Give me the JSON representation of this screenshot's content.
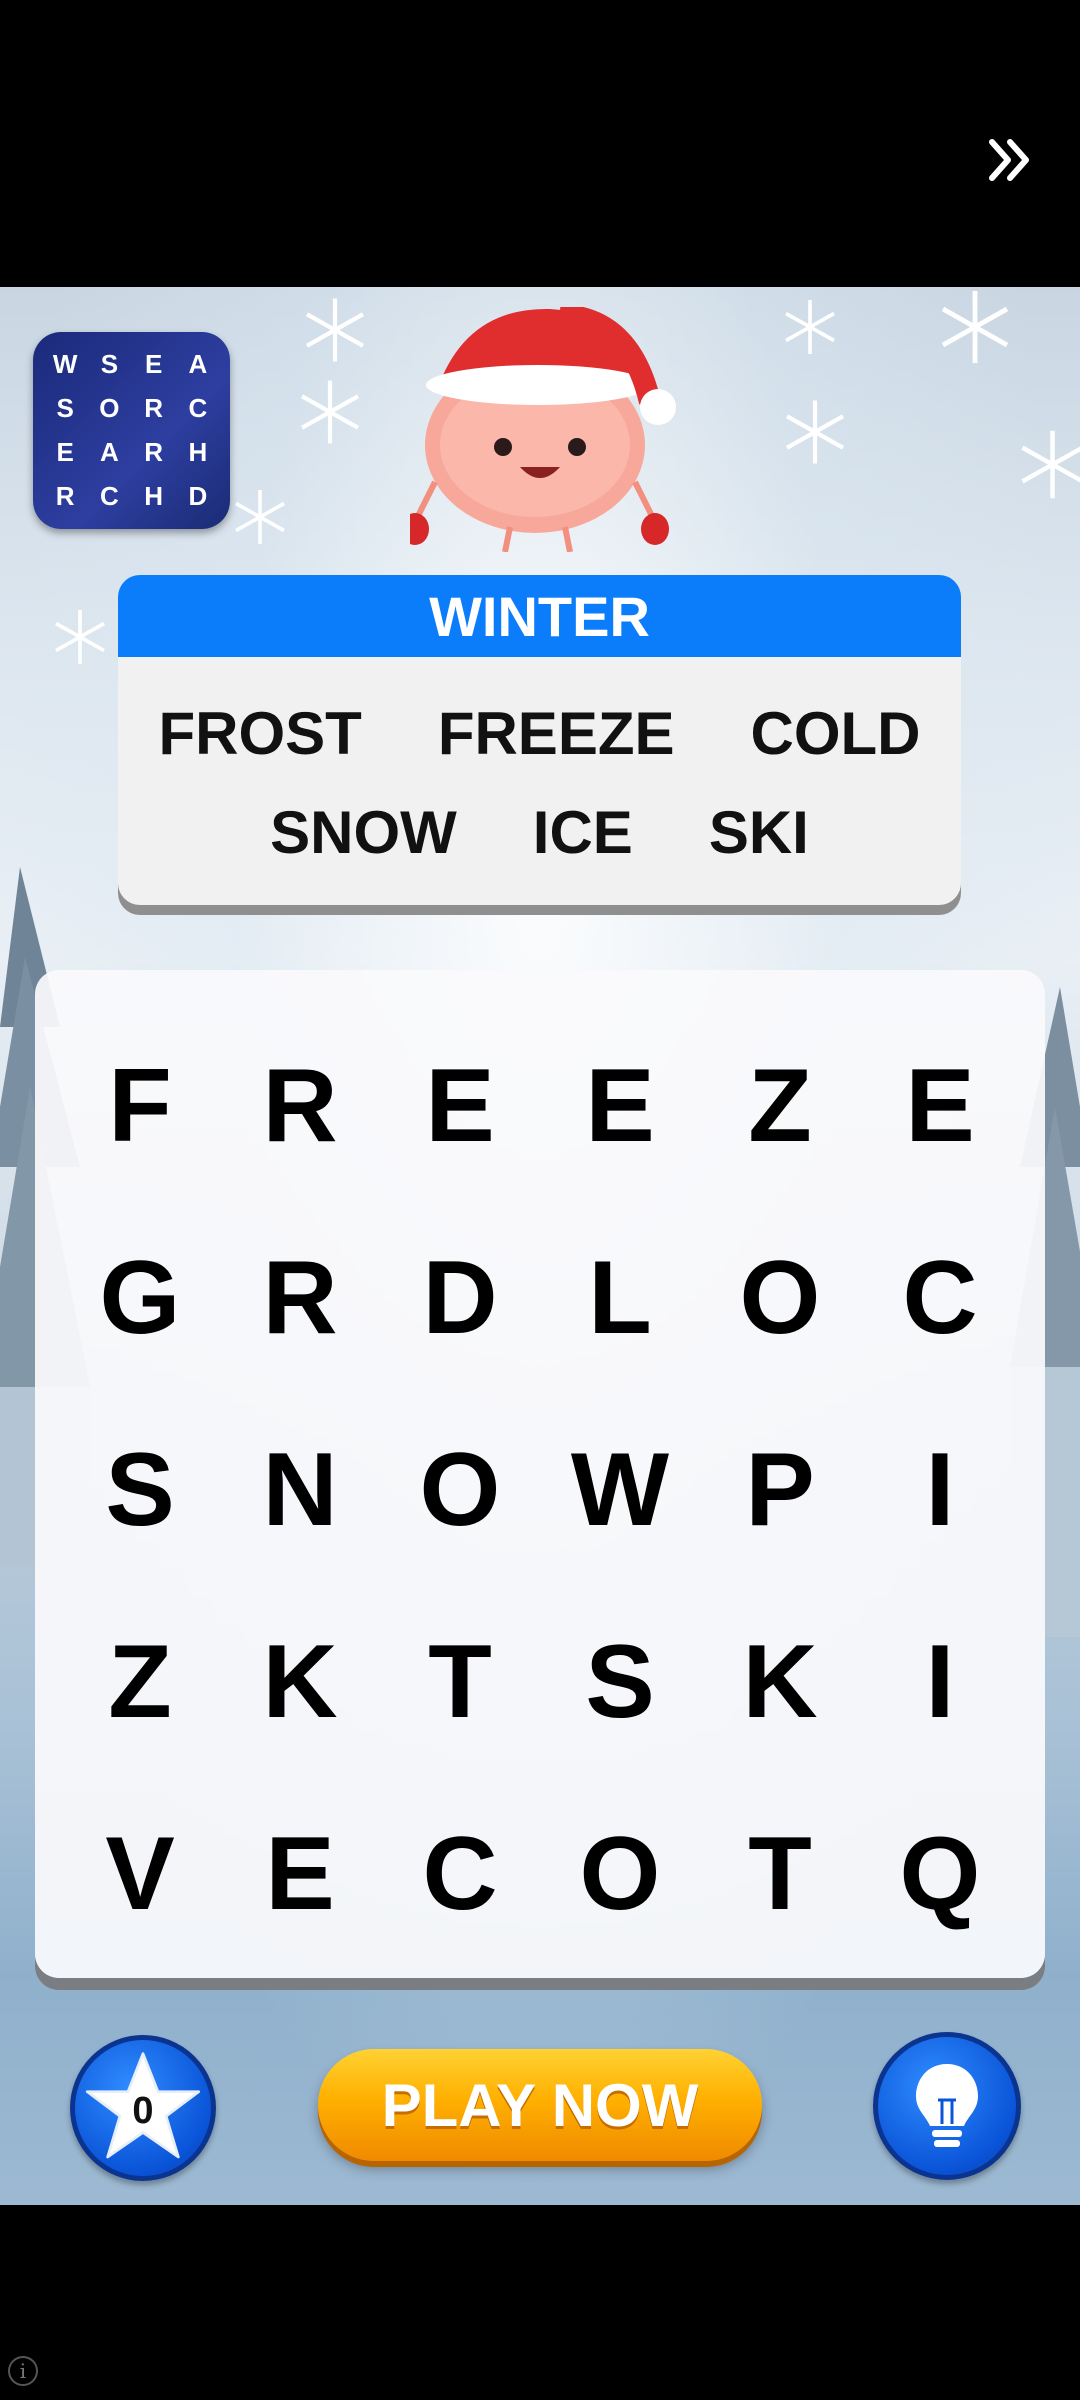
{
  "ad": {
    "skip_icon": "double-chevron-right-icon"
  },
  "logo": {
    "letters": [
      "W",
      "S",
      "E",
      "A",
      "S",
      "O",
      "R",
      "C",
      "E",
      "A",
      "R",
      "H",
      "R",
      "C",
      "H",
      "D"
    ]
  },
  "card": {
    "title": "WINTER",
    "words_row1": [
      "FROST",
      "FREEZE",
      "COLD"
    ],
    "words_row2": [
      "SNOW",
      "ICE",
      "SKI"
    ]
  },
  "grid": {
    "rows": [
      [
        "F",
        "R",
        "E",
        "E",
        "Z",
        "E"
      ],
      [
        "G",
        "R",
        "D",
        "L",
        "O",
        "C"
      ],
      [
        "S",
        "N",
        "O",
        "W",
        "P",
        "I"
      ],
      [
        "Z",
        "K",
        "T",
        "S",
        "K",
        "I"
      ],
      [
        "V",
        "E",
        "C",
        "O",
        "T",
        "Q"
      ]
    ]
  },
  "footer": {
    "star_count": "0",
    "play_label": "PLAY NOW",
    "hint_icon": "lightbulb-icon",
    "star_icon": "star-icon"
  },
  "colors": {
    "header_blue": "#0b7dfb",
    "play_orange": "#ffb000",
    "button_blue": "#0a54d8"
  }
}
